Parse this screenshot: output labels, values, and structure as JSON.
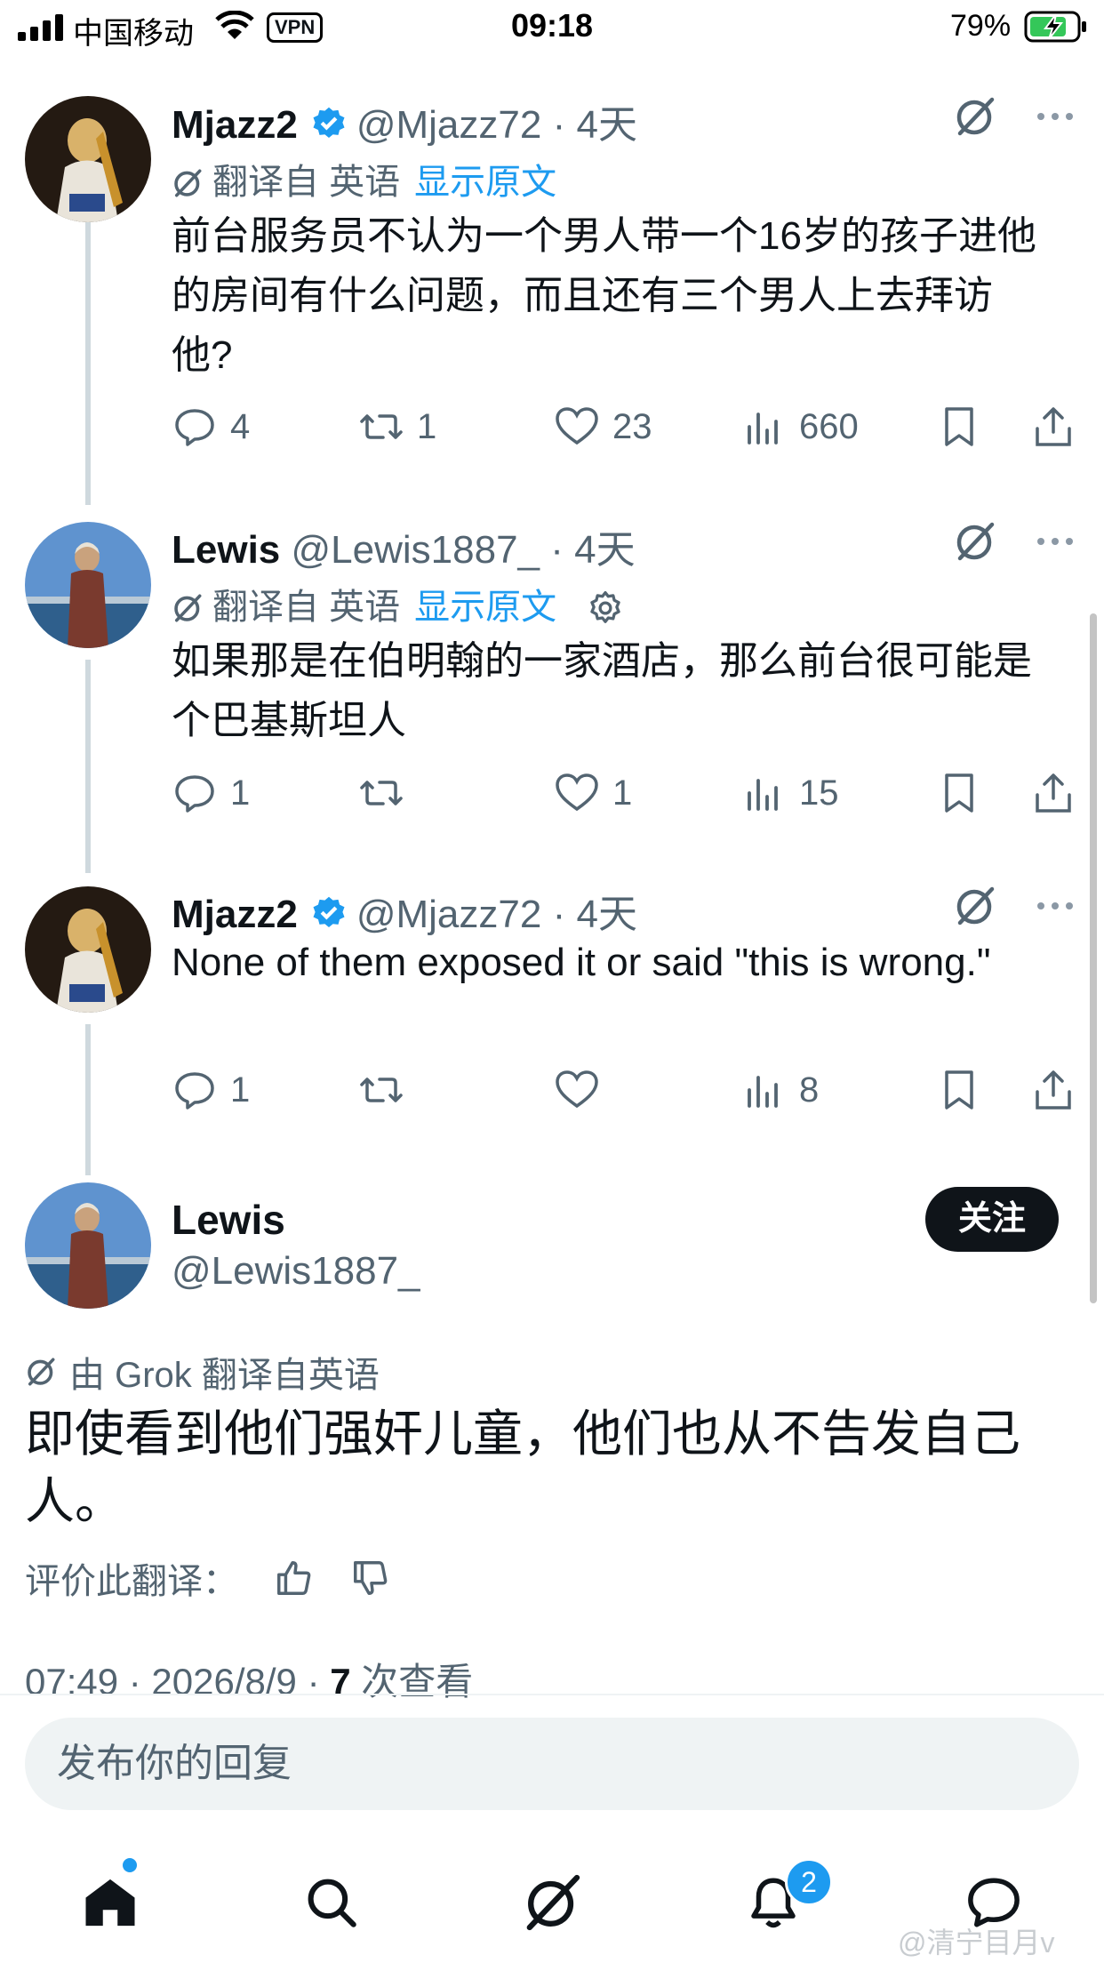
{
  "status_bar": {
    "carrier": "中国移动",
    "vpn": "VPN",
    "time": "09:18",
    "battery": "79%"
  },
  "thread": [
    {
      "name": "Mjazz2",
      "verified": true,
      "handle": "@Mjazz72",
      "dot": "·",
      "time_ago": "4天",
      "translated_from": "翻译自 英语",
      "show_original": "显示原文",
      "text": "前台服务员不认为一个男人带一个16岁的孩子进他的房间有什么问题，而且还有三个男人上去拜访他?",
      "replies": "4",
      "reposts": "1",
      "likes": "23",
      "views": "660"
    },
    {
      "name": "Lewis",
      "verified": false,
      "handle": "@Lewis1887_",
      "dot": "·",
      "time_ago": "4天",
      "translated_from": "翻译自 英语",
      "show_original": "显示原文",
      "text": "如果那是在伯明翰的一家酒店，那么前台很可能是个巴基斯坦人",
      "replies": "1",
      "reposts": "",
      "likes": "1",
      "views": "15"
    },
    {
      "name": "Mjazz2",
      "verified": true,
      "handle": "@Mjazz72",
      "dot": "·",
      "time_ago": "4天",
      "text": "None of them exposed it or said \"this is wrong.\"",
      "replies": "1",
      "reposts": "",
      "likes": "",
      "views": "8"
    }
  ],
  "main_tweet": {
    "name": "Lewis",
    "handle": "@Lewis1887_",
    "follow_label": "关注",
    "grok_note": "由 Grok 翻译自英语",
    "text": "即使看到他们强奸儿童，他们也从不告发自己人。",
    "rate_label": "评价此翻译：",
    "timestamp": "07:49 · 2026/8/9 · ",
    "views_count": "7",
    "views_label": " 次查看"
  },
  "reply_box": {
    "placeholder": "发布你的回复"
  },
  "nav": {
    "items": [
      "home-icon",
      "search-icon",
      "grok-icon",
      "notifications-icon",
      "messages-icon"
    ],
    "notifications_badge": "2"
  },
  "watermark": "@清宁目月v",
  "colors": {
    "accent": "#1d9bf0",
    "text": "#0f1419",
    "muted": "#536471"
  }
}
